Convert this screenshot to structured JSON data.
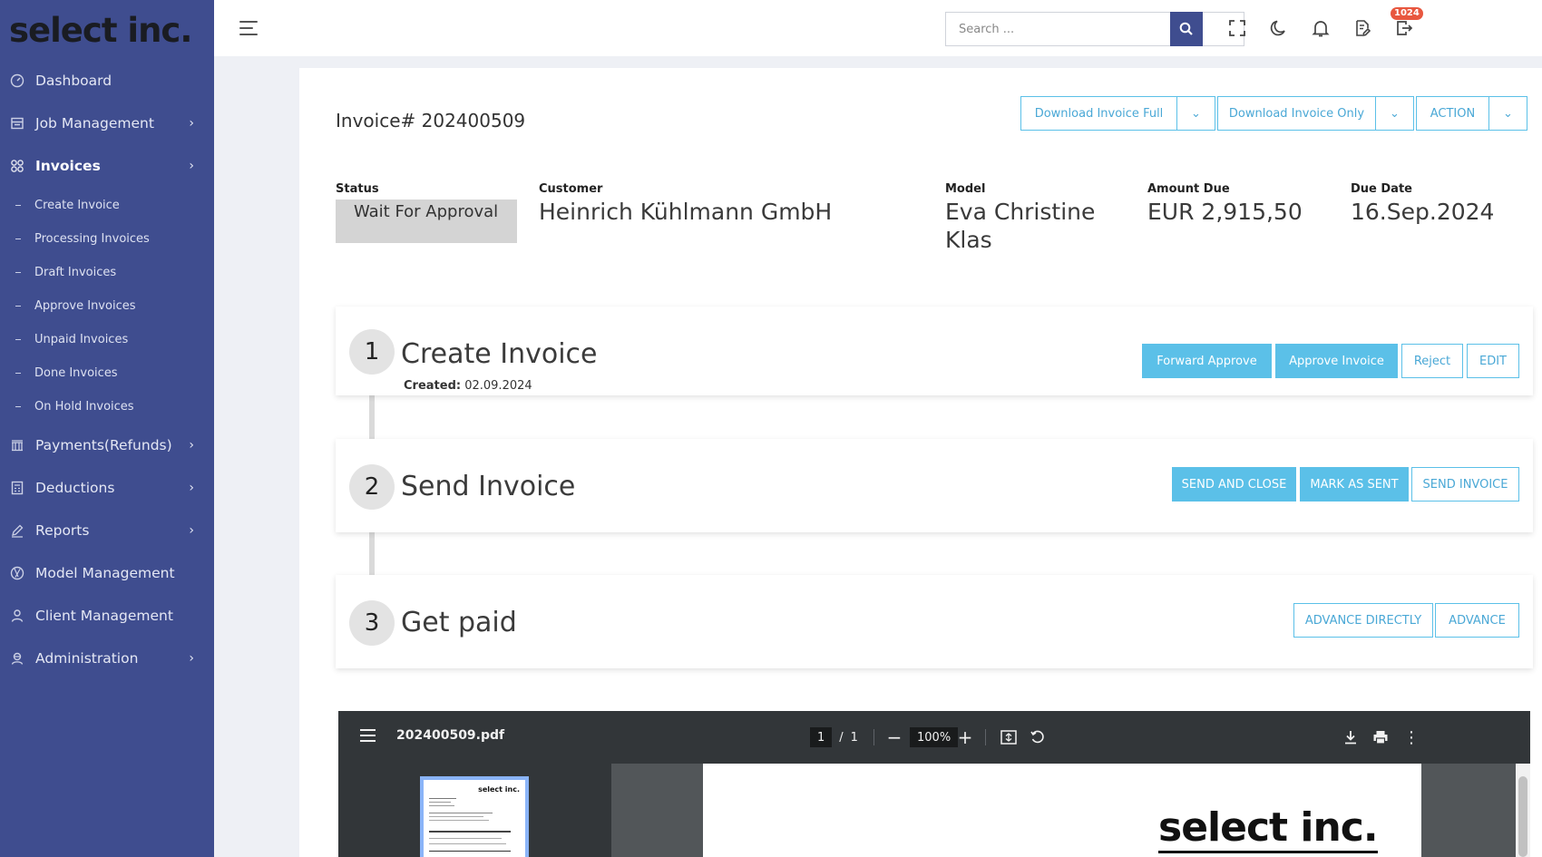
{
  "brand": {
    "logo_text": "select inc."
  },
  "sidebar": {
    "items": [
      {
        "label": "Dashboard",
        "icon": "gauge-icon",
        "has_chevron": false
      },
      {
        "label": "Job Management",
        "icon": "inbox-icon",
        "has_chevron": true
      },
      {
        "label": "Invoices",
        "icon": "grid-icon",
        "has_chevron": true,
        "active": true
      },
      {
        "label": "Payments(Refunds)",
        "icon": "bank-icon",
        "has_chevron": true
      },
      {
        "label": "Deductions",
        "icon": "calculator-icon",
        "has_chevron": true
      },
      {
        "label": "Reports",
        "icon": "pen-icon",
        "has_chevron": true
      },
      {
        "label": "Model Management",
        "icon": "aperture-icon",
        "has_chevron": false
      },
      {
        "label": "Client Management",
        "icon": "user-icon",
        "has_chevron": false
      },
      {
        "label": "Administration",
        "icon": "admin-icon",
        "has_chevron": true
      }
    ],
    "invoice_subitems": [
      "Create Invoice",
      "Processing Invoices",
      "Draft Invoices",
      "Approve Invoices",
      "Unpaid Invoices",
      "Done Invoices",
      "On Hold Invoices"
    ]
  },
  "topbar": {
    "search_placeholder": "Search ...",
    "notification_count": "1024"
  },
  "invoice": {
    "title": "Invoice# 202400509",
    "buttons": {
      "download_full": "Download Invoice Full",
      "download_only": "Download Invoice Only",
      "action": "ACTION"
    },
    "fields": {
      "status_label": "Status",
      "status_value": "Wait For Approval",
      "customer_label": "Customer",
      "customer_value": "Heinrich Kühlmann GmbH",
      "model_label": "Model",
      "model_value_line1": "Eva Christine",
      "model_value_line2": "Klas",
      "amount_label": "Amount Due",
      "amount_value": "EUR 2,915,50",
      "due_label": "Due Date",
      "due_value": "16.Sep.2024"
    }
  },
  "steps": [
    {
      "number": "1",
      "title": "Create Invoice",
      "created_label": "Created:",
      "created_value": "02.09.2024",
      "buttons": {
        "forward_approve": "Forward Approve",
        "approve_invoice": "Approve Invoice",
        "reject": "Reject",
        "edit": "EDIT"
      }
    },
    {
      "number": "2",
      "title": "Send Invoice",
      "buttons": {
        "send_and_close": "SEND AND CLOSE",
        "mark_as_sent": "MARK AS SENT",
        "send_invoice": "SEND INVOICE"
      }
    },
    {
      "number": "3",
      "title": "Get paid",
      "buttons": {
        "advance_directly": "ADVANCE DIRECTLY",
        "advance": "ADVANCE"
      }
    }
  ],
  "pdf_viewer": {
    "filename": "202400509.pdf",
    "current_page": "1",
    "page_separator": "/",
    "total_pages": "1",
    "zoom": "100%",
    "page_logo_text": "select inc.",
    "thumb_logo_text": "select inc."
  },
  "colors": {
    "sidebar_bg": "#3f4d8f",
    "accent": "#5bc0e8",
    "badge": "#e8573f",
    "pdf_toolbar": "#323639"
  }
}
